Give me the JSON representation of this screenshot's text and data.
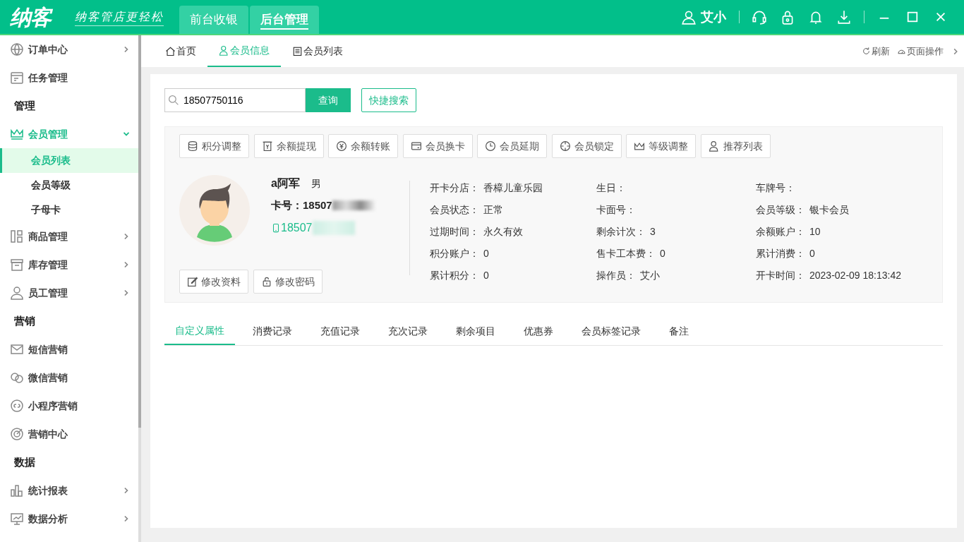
{
  "header": {
    "logo": "纳客",
    "slogan": "纳客管店更轻松",
    "modes": [
      {
        "label": "前台收银",
        "selected": false
      },
      {
        "label": "后台管理",
        "selected": true
      }
    ],
    "user": "艾小"
  },
  "sidebar": {
    "items": [
      {
        "kind": "group",
        "label": "订单中心",
        "expanded": false
      },
      {
        "kind": "link",
        "label": "任务管理"
      },
      {
        "kind": "section",
        "label": "管理"
      },
      {
        "kind": "group",
        "label": "会员管理",
        "expanded": true,
        "children": [
          {
            "label": "会员列表",
            "selected": true
          },
          {
            "label": "会员等级",
            "selected": false
          },
          {
            "label": "子母卡",
            "selected": false
          }
        ]
      },
      {
        "kind": "group",
        "label": "商品管理",
        "expanded": false
      },
      {
        "kind": "group",
        "label": "库存管理",
        "expanded": false
      },
      {
        "kind": "group",
        "label": "员工管理",
        "expanded": false
      },
      {
        "kind": "section",
        "label": "营销"
      },
      {
        "kind": "link",
        "label": "短信营销"
      },
      {
        "kind": "link",
        "label": "微信营销"
      },
      {
        "kind": "link",
        "label": "小程序营销"
      },
      {
        "kind": "link",
        "label": "营销中心"
      },
      {
        "kind": "section",
        "label": "数据"
      },
      {
        "kind": "group",
        "label": "统计报表",
        "expanded": false
      },
      {
        "kind": "group",
        "label": "数据分析",
        "expanded": false
      }
    ]
  },
  "page_tabs": [
    {
      "label": "首页",
      "selected": false
    },
    {
      "label": "会员信息",
      "selected": true
    },
    {
      "label": "会员列表",
      "selected": false
    }
  ],
  "page_actions": [
    "刷新",
    "页面操作"
  ],
  "search": {
    "value": "18507750116",
    "button": "查询",
    "quick_search": "快捷搜索"
  },
  "actions": [
    "积分调整",
    "余额提现",
    "余额转账",
    "会员换卡",
    "会员延期",
    "会员锁定",
    "等级调整",
    "推荐列表"
  ],
  "member": {
    "name": "a阿军",
    "gender": "男",
    "card_label": "卡号：",
    "card_value": "18507",
    "phone": "18507"
  },
  "member_buttons": [
    "修改资料",
    "修改密码"
  ],
  "info": [
    {
      "label": "开卡分店：",
      "value": "香樟儿童乐园"
    },
    {
      "label": "生日："
    },
    {
      "label": "车牌号："
    },
    {
      "label": "会员状态：",
      "value": "正常"
    },
    {
      "label": "卡面号："
    },
    {
      "label": "会员等级：",
      "value": "银卡会员"
    },
    {
      "label": "过期时间：",
      "value": "永久有效"
    },
    {
      "label": "剩余计次：",
      "value": "3"
    },
    {
      "label": "余额账户：",
      "value": "10"
    },
    {
      "label": "积分账户：",
      "value": "0"
    },
    {
      "label": "售卡工本费：",
      "value": "0"
    },
    {
      "label": "累计消费：",
      "value": "0"
    },
    {
      "label": "累计积分：",
      "value": "0"
    },
    {
      "label": "操作员：",
      "value": "艾小"
    },
    {
      "label": "开卡时间：",
      "value": "2023-02-09 18:13:42"
    }
  ],
  "detail_tabs": [
    {
      "label": "自定义属性",
      "selected": true
    },
    {
      "label": "消费记录",
      "selected": false
    },
    {
      "label": "充值记录",
      "selected": false
    },
    {
      "label": "充次记录",
      "selected": false
    },
    {
      "label": "剩余项目",
      "selected": false
    },
    {
      "label": "优惠券",
      "selected": false
    },
    {
      "label": "会员标签记录",
      "selected": false
    },
    {
      "label": "备注",
      "selected": false
    }
  ]
}
